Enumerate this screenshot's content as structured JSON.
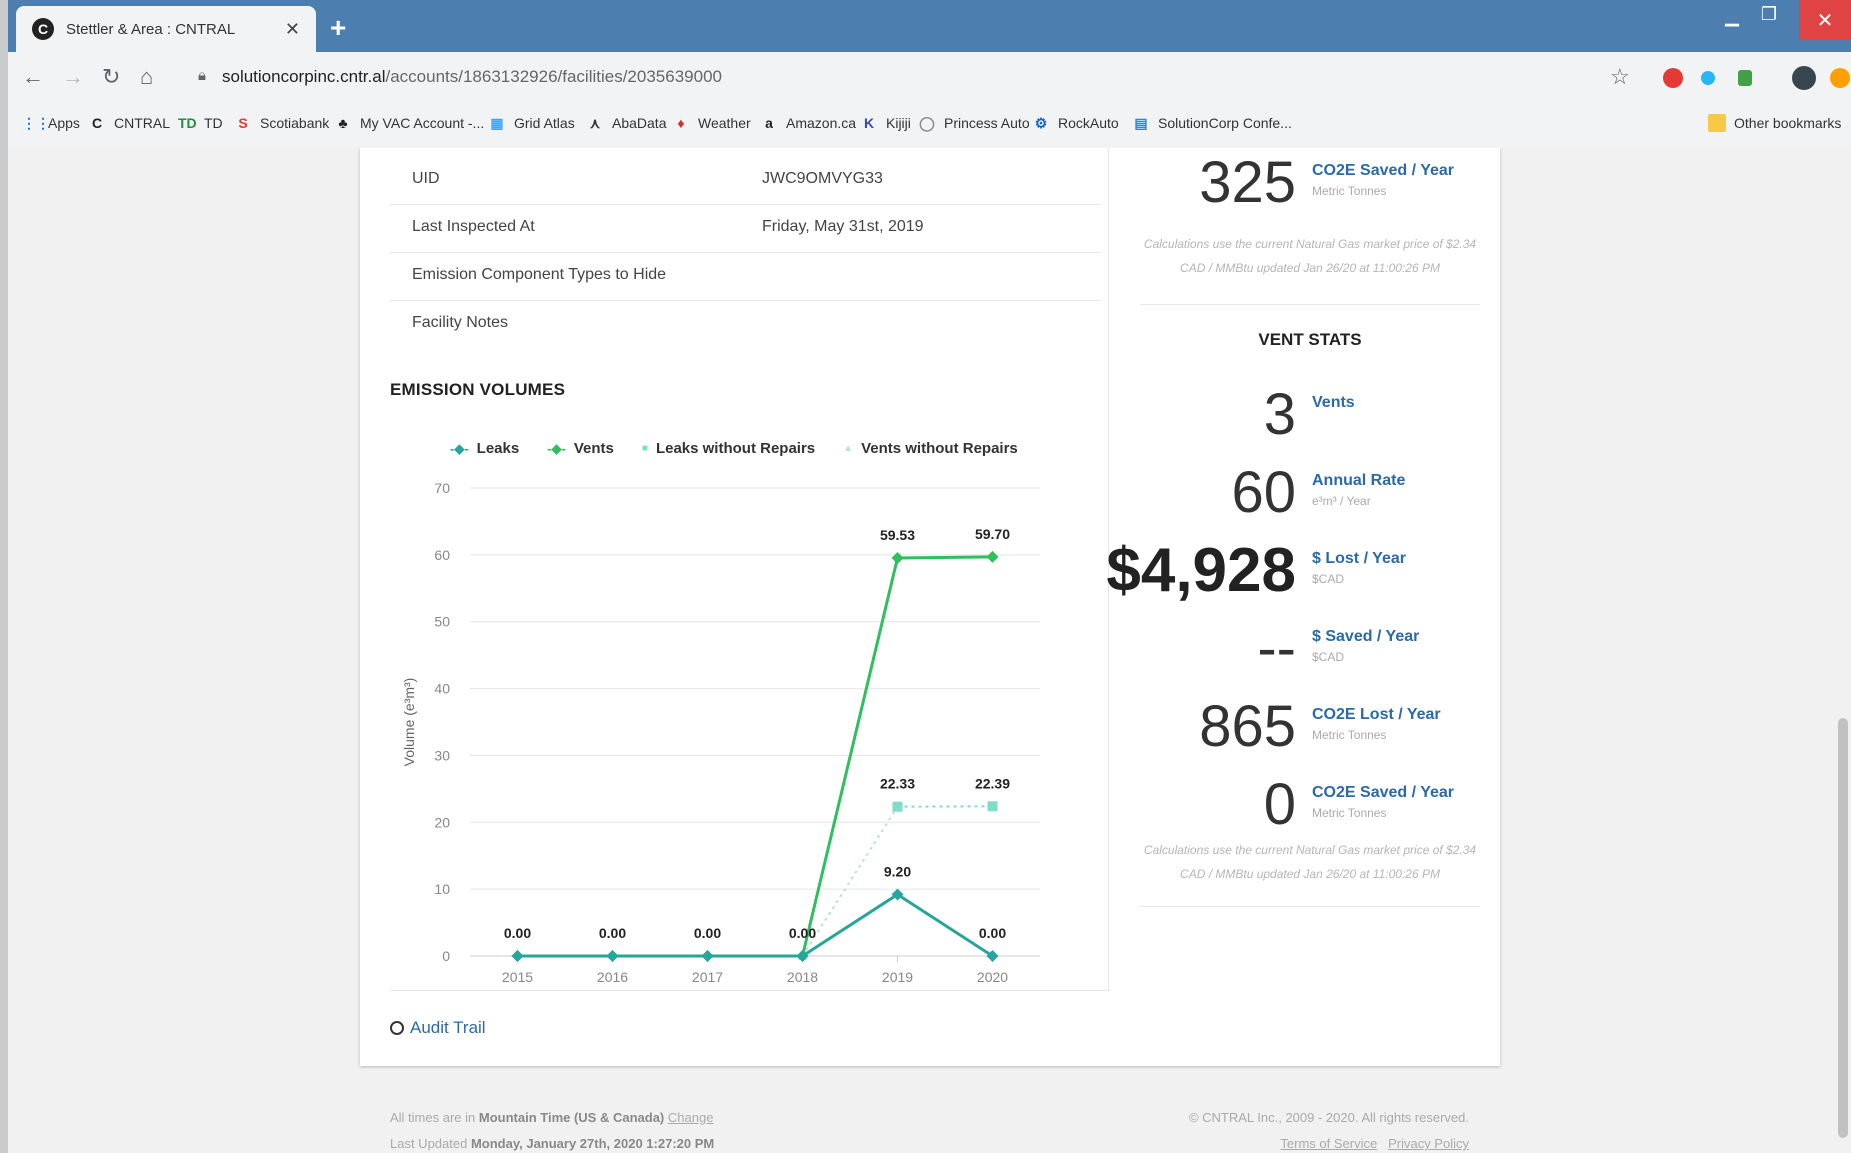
{
  "browser": {
    "tab_title": "Stettler & Area : CNTRAL",
    "new_tab": "+",
    "url_host": "solutioncorpinc.cntr.al",
    "url_path": "/accounts/1863132926/facilities/2035639000",
    "bookmarks": [
      {
        "label": "Apps",
        "icon": "apps-grid-icon",
        "color": "#1a73e8"
      },
      {
        "label": "CNTRAL",
        "icon": "cntral-logo-icon",
        "color": "#222222"
      },
      {
        "label": "TD",
        "icon": "td-logo-icon",
        "color": "#2b8a3e"
      },
      {
        "label": "Scotiabank",
        "icon": "scotiabank-logo-icon",
        "color": "#e53935"
      },
      {
        "label": "My VAC Account -...",
        "icon": "maple-leaf-icon",
        "color": "#222222"
      },
      {
        "label": "Grid Atlas",
        "icon": "grid-atlas-icon",
        "color": "#42a5f5"
      },
      {
        "label": "AbaData",
        "icon": "abadata-icon",
        "color": "#333333"
      },
      {
        "label": "Weather",
        "icon": "weather-leaf-icon",
        "color": "#d32f2f"
      },
      {
        "label": "Amazon.ca",
        "icon": "amazon-icon",
        "color": "#222222"
      },
      {
        "label": "Kijiji",
        "icon": "kijiji-icon",
        "color": "#3949ab"
      },
      {
        "label": "Princess Auto",
        "icon": "princess-auto-icon",
        "color": "#888888"
      },
      {
        "label": "RockAuto",
        "icon": "rockauto-icon",
        "color": "#1565c0"
      },
      {
        "label": "SolutionCorp Confe...",
        "icon": "doc-icon",
        "color": "#1e88e5"
      }
    ],
    "other_bookmarks": "Other bookmarks"
  },
  "facility": {
    "rows": [
      {
        "key": "UID",
        "value": "JWC9OMVYG33"
      },
      {
        "key": "Last Inspected At",
        "value": "Friday, May 31st, 2019"
      },
      {
        "key": "Emission Component Types to Hide",
        "value": ""
      },
      {
        "key": "Facility Notes",
        "value": ""
      }
    ]
  },
  "emission_title": "EMISSION VOLUMES",
  "audit_trail": "Audit Trail",
  "chart_data": {
    "type": "line",
    "title": "",
    "xlabel": "",
    "ylabel": "Volume (e³m³)",
    "categories": [
      "2015",
      "2016",
      "2017",
      "2018",
      "2019",
      "2020"
    ],
    "ylim": [
      0,
      70
    ],
    "yticks": [
      0,
      10,
      20,
      30,
      40,
      50,
      60,
      70
    ],
    "grid": true,
    "legend": "top",
    "series": [
      {
        "name": "Leaks",
        "values": [
          0,
          0,
          0,
          0,
          9.2,
          0
        ],
        "labels": [
          "0.00",
          "0.00",
          "0.00",
          "0.00",
          "9.20",
          "0.00"
        ],
        "color": "#26a69a",
        "style": "solid",
        "marker": "diamond"
      },
      {
        "name": "Vents",
        "values": [
          0,
          0,
          0,
          0,
          59.53,
          59.7
        ],
        "labels": [
          "",
          "",
          "",
          "",
          "59.53",
          "59.70"
        ],
        "color": "#2fbf5f",
        "style": "solid",
        "marker": "diamond"
      },
      {
        "name": "Leaks without Repairs",
        "values": [
          null,
          null,
          null,
          null,
          22.33,
          22.39
        ],
        "labels": [
          "",
          "",
          "",
          "",
          "22.33",
          "22.39"
        ],
        "color": "#7fdcc8",
        "style": "dotted",
        "marker": "square"
      },
      {
        "name": "Vents without Repairs",
        "values": [
          null,
          null,
          null,
          0,
          22.33,
          null
        ],
        "labels": [
          "",
          "",
          "",
          "",
          "",
          ""
        ],
        "color": "#b7e6cf",
        "style": "dotted",
        "marker": "triangle"
      }
    ]
  },
  "stats_top": {
    "value": "325",
    "label": "CO2E Saved / Year",
    "sub": "Metric Tonnes",
    "calc": "Calculations use the current Natural Gas market price of $2.34 CAD / MMBtu updated Jan 26/20 at 11:00:26 PM"
  },
  "vent_stats": {
    "title": "VENT STATS",
    "items": [
      {
        "value": "3",
        "label": "Vents",
        "sub": ""
      },
      {
        "value": "60",
        "label": "Annual Rate",
        "sub": "e³m³ / Year"
      },
      {
        "value": "$4,928",
        "label": "$ Lost / Year",
        "sub": "$CAD"
      },
      {
        "value": "--",
        "label": "$ Saved / Year",
        "sub": "$CAD"
      },
      {
        "value": "865",
        "label": "CO2E Lost / Year",
        "sub": "Metric Tonnes"
      },
      {
        "value": "0",
        "label": "CO2E Saved / Year",
        "sub": "Metric Tonnes"
      }
    ],
    "calc": "Calculations use the current Natural Gas market price of $2.34 CAD / MMBtu updated Jan 26/20 at 11:00:26 PM"
  },
  "footer": {
    "tz_prefix": "All times are in",
    "tz": "Mountain Time (US & Canada)",
    "tz_change": "Change",
    "updated_prefix": "Last Updated",
    "updated": "Monday, January 27th, 2020 1:27:20 PM",
    "copyright": "© CNTRAL Inc., 2009 - 2020. All rights reserved.",
    "terms": "Terms of Service",
    "privacy": "Privacy Policy"
  },
  "colors": {
    "accent": "#2b6aa6",
    "tabbar": "#4c7eb0"
  }
}
